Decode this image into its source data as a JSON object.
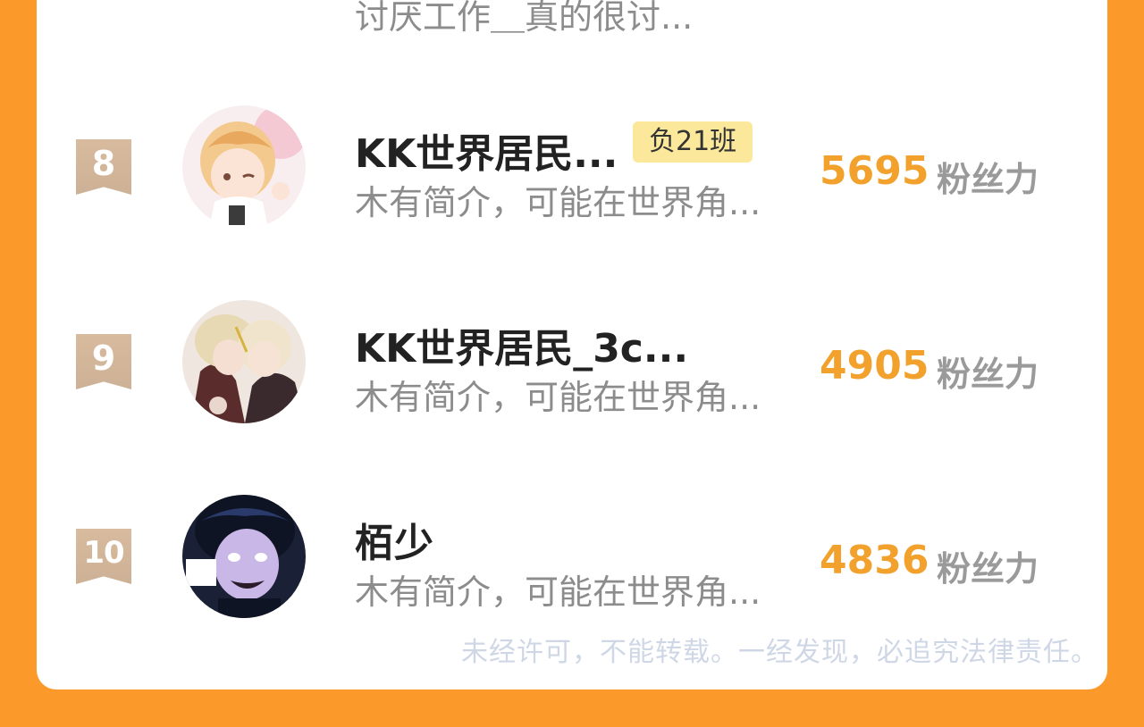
{
  "top_partial": {
    "bio": "讨厌工作＿真的很讨..."
  },
  "entries": [
    {
      "rank": "8",
      "name": "KK世界居民...",
      "tag": "负21班",
      "bio": "木有简介，可能在世界角...",
      "score": "5695",
      "unit": "粉丝力"
    },
    {
      "rank": "9",
      "name": "KK世界居民_3c...",
      "bio": "木有简介，可能在世界角...",
      "score": "4905",
      "unit": "粉丝力"
    },
    {
      "rank": "10",
      "name": "栢少",
      "bio": "木有简介，可能在世界角...",
      "score": "4836",
      "unit": "粉丝力"
    }
  ],
  "footer": {
    "notice": "未经许可，不能转载。一经发现，必追究法律责任。"
  },
  "colors": {
    "page_bg": "#fb9a2b",
    "card_bg": "#ffffff",
    "score": "#f2a12c",
    "badge": "#d4b89b",
    "tag_bg": "#fbe89b"
  }
}
